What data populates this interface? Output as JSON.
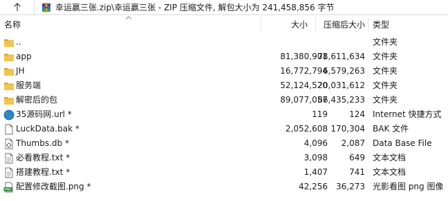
{
  "path_bar": {
    "up_icon": "up-arrow-icon",
    "archive_icon": "winrar-archive-icon",
    "path_text": "幸运赢三张.zip\\幸运赢三张 - ZIP 压缩文件, 解包大小为 241,458,856 字节"
  },
  "columns": {
    "name": "名称",
    "size": "大小",
    "packed": "压缩后大小",
    "type": "类型",
    "sort_icon": "chevron-up-icon"
  },
  "files": [
    {
      "icon": "folder-up-icon",
      "name": "..",
      "size": "",
      "packed": "",
      "type": "文件夹"
    },
    {
      "icon": "folder-icon",
      "name": "app",
      "size": "81,380,901",
      "packed": "78,611,634",
      "type": "文件夹"
    },
    {
      "icon": "folder-icon",
      "name": "JH",
      "size": "16,772,794",
      "packed": "6,579,263",
      "type": "文件夹"
    },
    {
      "icon": "folder-icon",
      "name": "服务端",
      "size": "52,124,520",
      "packed": "20,031,612",
      "type": "文件夹"
    },
    {
      "icon": "folder-icon",
      "name": "解密后的包",
      "size": "89,077,057",
      "packed": "86,435,233",
      "type": "文件夹"
    },
    {
      "icon": "internet-shortcut-icon",
      "name": "35源码网.url *",
      "size": "119",
      "packed": "124",
      "type": "Internet 快捷方式"
    },
    {
      "icon": "file-icon",
      "name": "LuckData.bak *",
      "size": "2,052,608",
      "packed": "170,304",
      "type": "BAK 文件"
    },
    {
      "icon": "database-file-icon",
      "name": "Thumbs.db *",
      "size": "4,096",
      "packed": "2,087",
      "type": "Data Base File"
    },
    {
      "icon": "text-file-icon",
      "name": "必看教程.txt *",
      "size": "3,098",
      "packed": "649",
      "type": "文本文档"
    },
    {
      "icon": "text-file-icon",
      "name": "搭建教程.txt *",
      "size": "1,407",
      "packed": "741",
      "type": "文本文档"
    },
    {
      "icon": "png-image-icon",
      "name": "配置修改截图.png *",
      "size": "42,256",
      "packed": "36,273",
      "type": "光影看图 png 图像"
    }
  ],
  "colors": {
    "folder": "#f3c54c",
    "folder_dark": "#dfa72c",
    "globe": "#2f7fd6",
    "globe_land": "#3fae49",
    "png_badge": "#2e8b3d"
  }
}
